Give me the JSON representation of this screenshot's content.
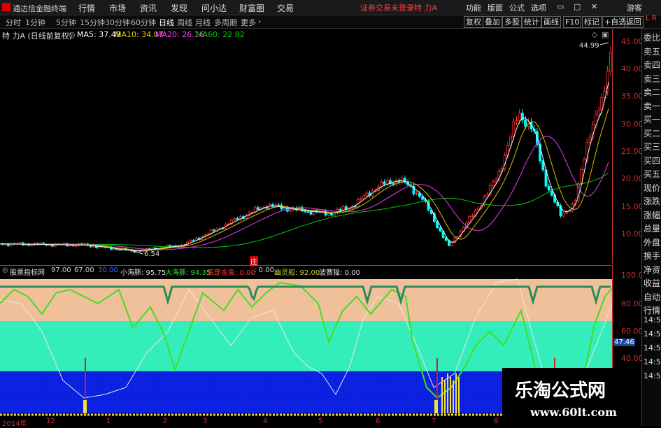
{
  "app": {
    "title": "通达信金融终端"
  },
  "menu": [
    "行情",
    "市场",
    "资讯",
    "发现",
    "问小达",
    "财富圈",
    "交易"
  ],
  "login_notice": "证券交易未登录",
  "stock_name": "特 力A",
  "menu_right": [
    "功能",
    "版面",
    "公式",
    "选项"
  ],
  "guest": "游客",
  "periods": [
    "分时",
    "1分钟",
    "5分钟",
    "15分钟",
    "30分钟",
    "60分钟",
    "日线",
    "周线",
    "月线",
    "多周期",
    "更多"
  ],
  "active_period": "日线",
  "right_buttons": [
    "复权",
    "叠加",
    "多股",
    "统计",
    "画线",
    "F10",
    "标记",
    "+自选",
    "返回"
  ],
  "info": {
    "title": "特 力A (日线前复权)",
    "ma5": "MA5: 37.49",
    "ma10": "MA10: 34.07",
    "ma20": "MA20: 26.16",
    "ma60": "MA60: 22.82"
  },
  "side_panel": [
    "委比",
    "卖五",
    "卖四",
    "卖三",
    "卖二",
    "卖一",
    "买一",
    "买二",
    "买三",
    "买四",
    "买五",
    "现价",
    "涨跌",
    "涨幅",
    "总量",
    "外盘",
    "换手",
    "净资",
    "收益",
    "自动",
    "行情"
  ],
  "side_times": [
    "14:5",
    "14:5",
    "14:5",
    "14:5",
    "14:5"
  ],
  "price_axis": [
    "45.00",
    "40.00",
    "35.00",
    "30.00",
    "25.00",
    "20.00",
    "15.00",
    "10.00"
  ],
  "price_max_label": "44.99",
  "price_min_label": "6.54",
  "indicator_axis": [
    "100.0",
    "80.00",
    "60.00",
    "40.00"
  ],
  "indicator_current": "47.46",
  "indicator": {
    "name": "股票指标网",
    "v1": "97.00",
    "v2": "67.00",
    "v3": "30.00",
    "shark": "小海豚: 95.75",
    "big_shark": "大海豚: 94.35",
    "seahorse": "底部金鱼: 0.00",
    "zero": ": 0.00",
    "ghost": "幽灵船: 92.00",
    "dragon": "波赛猫: 0.00"
  },
  "x_axis": [
    "2014年",
    "12",
    "1",
    "2",
    "3",
    "4",
    "5",
    "6",
    "7",
    "8"
  ],
  "marker": "庄",
  "watermark": {
    "title": "乐淘公式网",
    "url": "www.60lt.com"
  },
  "colors": {
    "ma5": "#ffffff",
    "ma10": "#e0d000",
    "ma20": "#ff40ff",
    "ma60": "#00cc00",
    "up": "#ff3333",
    "down": "#00ffff"
  }
}
